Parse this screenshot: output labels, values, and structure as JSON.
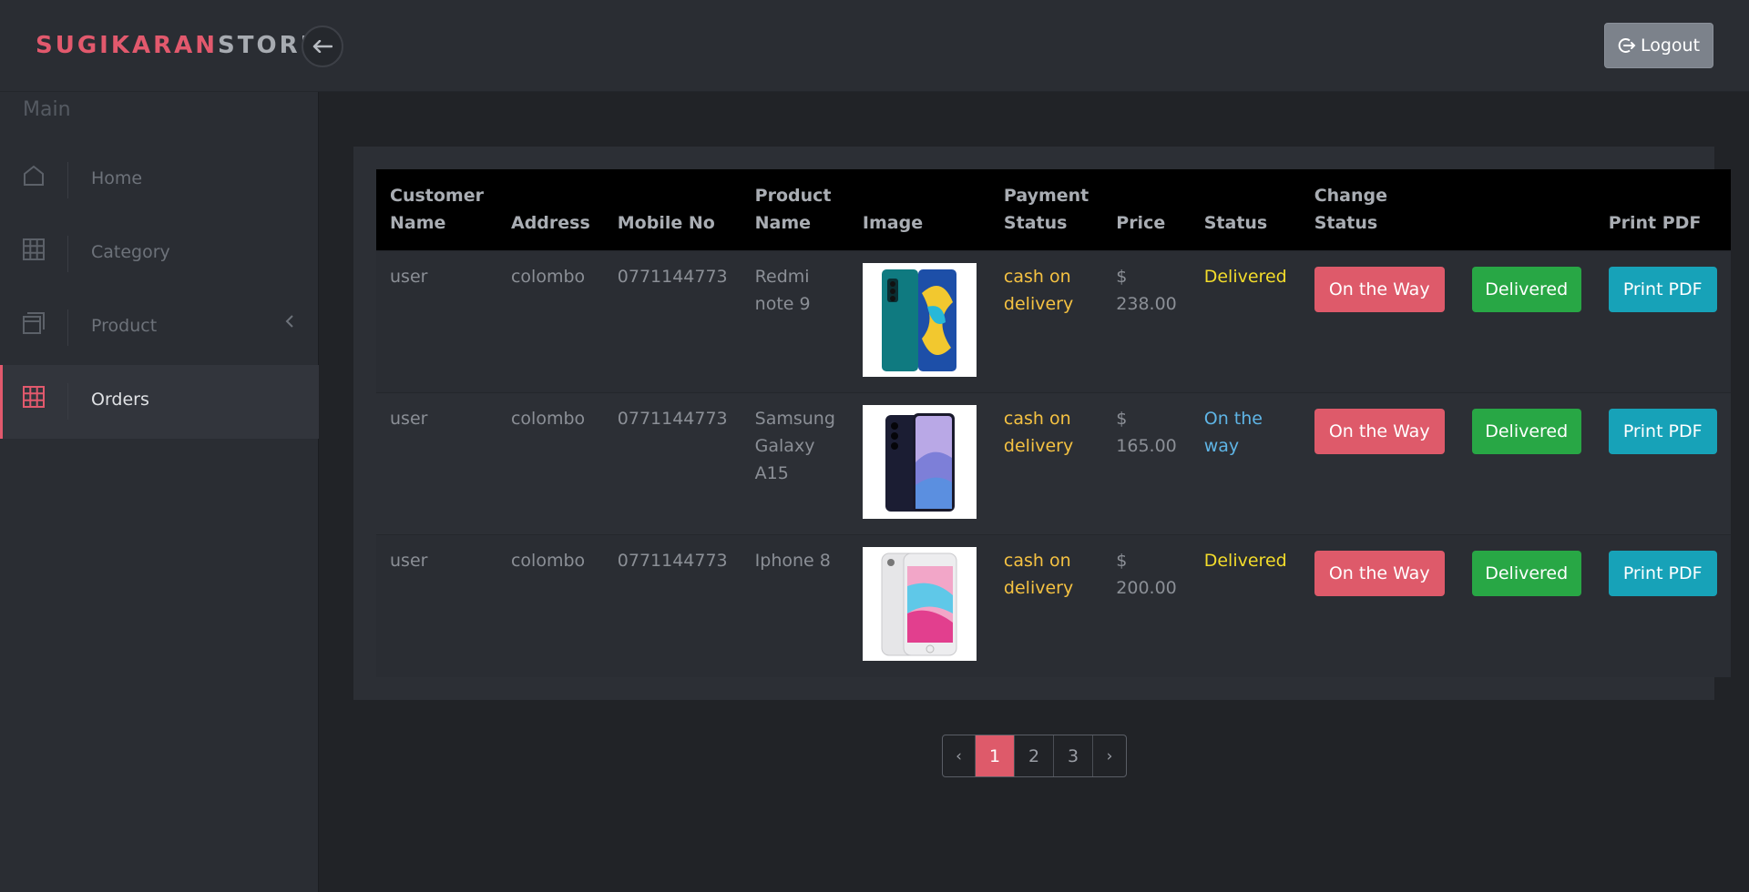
{
  "brand": {
    "part1": "SUGIKARAN",
    "part2": "STORE"
  },
  "header": {
    "logout_label": "Logout"
  },
  "sidebar": {
    "heading": "Main",
    "items": [
      {
        "label": "Home",
        "icon": "home-icon"
      },
      {
        "label": "Category",
        "icon": "grid-icon"
      },
      {
        "label": "Product",
        "icon": "layers-icon",
        "has_submenu": true
      },
      {
        "label": "Orders",
        "icon": "grid-icon",
        "active": true
      }
    ]
  },
  "table": {
    "headers": {
      "customer_name": "Customer Name",
      "address": "Address",
      "mobile": "Mobile No",
      "product_name": "Product Name",
      "image": "Image",
      "payment_status": "Payment Status",
      "price": "Price",
      "status": "Status",
      "change_status": "Change Status",
      "print_pdf": "Print PDF"
    },
    "rows": [
      {
        "customer": "user",
        "address": "colombo",
        "mobile": "0771144773",
        "product": "Redmi note 9",
        "image": "redmi-note-9-phone-image",
        "payment": "cash on delivery",
        "price": "$ 238.00",
        "status": "Delivered",
        "btn_way": "On the Way",
        "btn_delivered": "Delivered",
        "btn_pdf": "Print PDF"
      },
      {
        "customer": "user",
        "address": "colombo",
        "mobile": "0771144773",
        "product": "Samsung Galaxy A15",
        "image": "samsung-galaxy-a15-phone-image",
        "payment": "cash on delivery",
        "price": "$ 165.00",
        "status": "On the way",
        "btn_way": "On the Way",
        "btn_delivered": "Delivered",
        "btn_pdf": "Print PDF"
      },
      {
        "customer": "user",
        "address": "colombo",
        "mobile": "0771144773",
        "product": "Iphone 8",
        "image": "iphone-8-phone-image",
        "payment": "cash on delivery",
        "price": "$ 200.00",
        "status": "Delivered",
        "btn_way": "On the Way",
        "btn_delivered": "Delivered",
        "btn_pdf": "Print PDF"
      }
    ]
  },
  "pagination": {
    "prev": "‹",
    "pages": [
      "1",
      "2",
      "3"
    ],
    "next": "›",
    "current": "1"
  },
  "colors": {
    "accent": "#e2596d",
    "success": "#28a745",
    "info": "#17a2b8",
    "payment_text": "#f5c242",
    "delivered_text": "#f3dc2b",
    "on_the_way_text": "#5fb5e6"
  }
}
